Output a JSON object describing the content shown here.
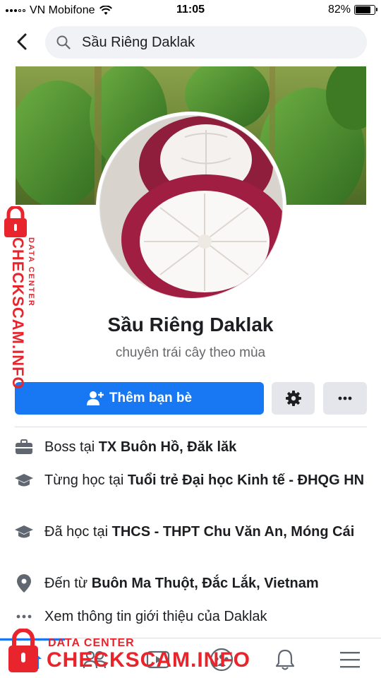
{
  "status_bar": {
    "carrier": "VN Mobifone",
    "time": "11:05",
    "battery": "82%",
    "battery_level": 0.82
  },
  "header": {
    "back_icon": "chevron-left-icon",
    "search_icon": "search-icon",
    "search_value": "Sầu Riêng Daklak"
  },
  "profile": {
    "name": "Sầu Riêng Daklak",
    "bio": "chuyên trái cây theo mùa",
    "cover_image": "green durian fruit photo",
    "avatar_image": "mangosteen fruit photo"
  },
  "actions": {
    "add_friend_label": "Thêm bạn bè",
    "add_friend_icon": "add-person-icon",
    "settings_icon": "gear-icon",
    "more_icon": "more-icon"
  },
  "info": [
    {
      "icon": "briefcase-icon",
      "prefix": "Boss tại ",
      "bold": "TX Buôn Hồ, Đăk lăk"
    },
    {
      "icon": "graduation-cap-icon",
      "prefix": "Từng học tại ",
      "bold": "Tuổi trẻ Đại học Kinh tế - ĐHQG HN"
    },
    {
      "icon": "graduation-cap-icon",
      "prefix": "Đã học tại ",
      "bold": "THCS - THPT Chu Văn An, Móng Cái"
    },
    {
      "icon": "location-pin-icon",
      "prefix": "Đến từ ",
      "bold": "Buôn Ma Thuột, Đắc Lắk, Vietnam"
    },
    {
      "icon": "dots-icon",
      "prefix": "Xem thông tin giới thiệu của Daklak",
      "bold": ""
    }
  ],
  "bottom_nav": [
    {
      "icon": "home-icon",
      "active": true
    },
    {
      "icon": "friends-icon",
      "active": false
    },
    {
      "icon": "video-icon",
      "active": false
    },
    {
      "icon": "groups-icon",
      "active": false
    },
    {
      "icon": "bell-icon",
      "active": false
    },
    {
      "icon": "menu-icon",
      "active": false
    }
  ],
  "watermark": {
    "small_text": "DATA CENTER",
    "big_text": "CHECKSCAM.INFO",
    "color": "#e8242c"
  },
  "colors": {
    "accent": "#1877f2",
    "secondary_button": "#e4e6eb",
    "search_bg": "#f0f2f5"
  }
}
